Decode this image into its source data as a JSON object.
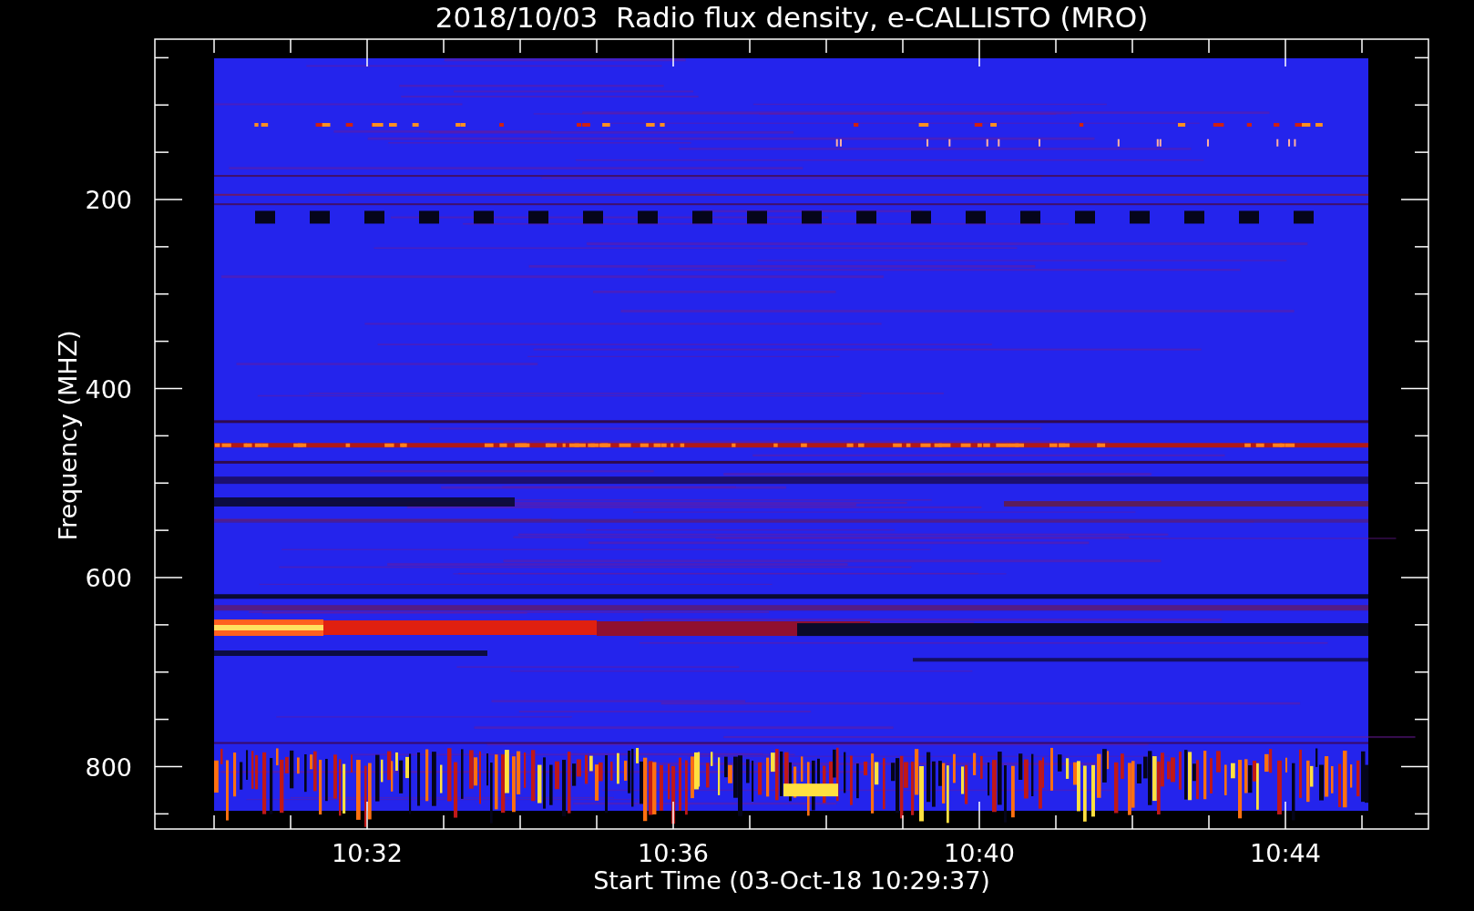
{
  "title": "2018/10/03  Radio flux density, e-CALLISTO (MRO)",
  "y_axis": {
    "label": "Frequency (MHZ)",
    "ticks": [
      "200",
      "400",
      "600",
      "800"
    ]
  },
  "x_axis": {
    "label": "Start Time (03-Oct-18 10:29:37)",
    "ticks": [
      "10:32",
      "10:36",
      "10:40",
      "10:44"
    ]
  }
}
